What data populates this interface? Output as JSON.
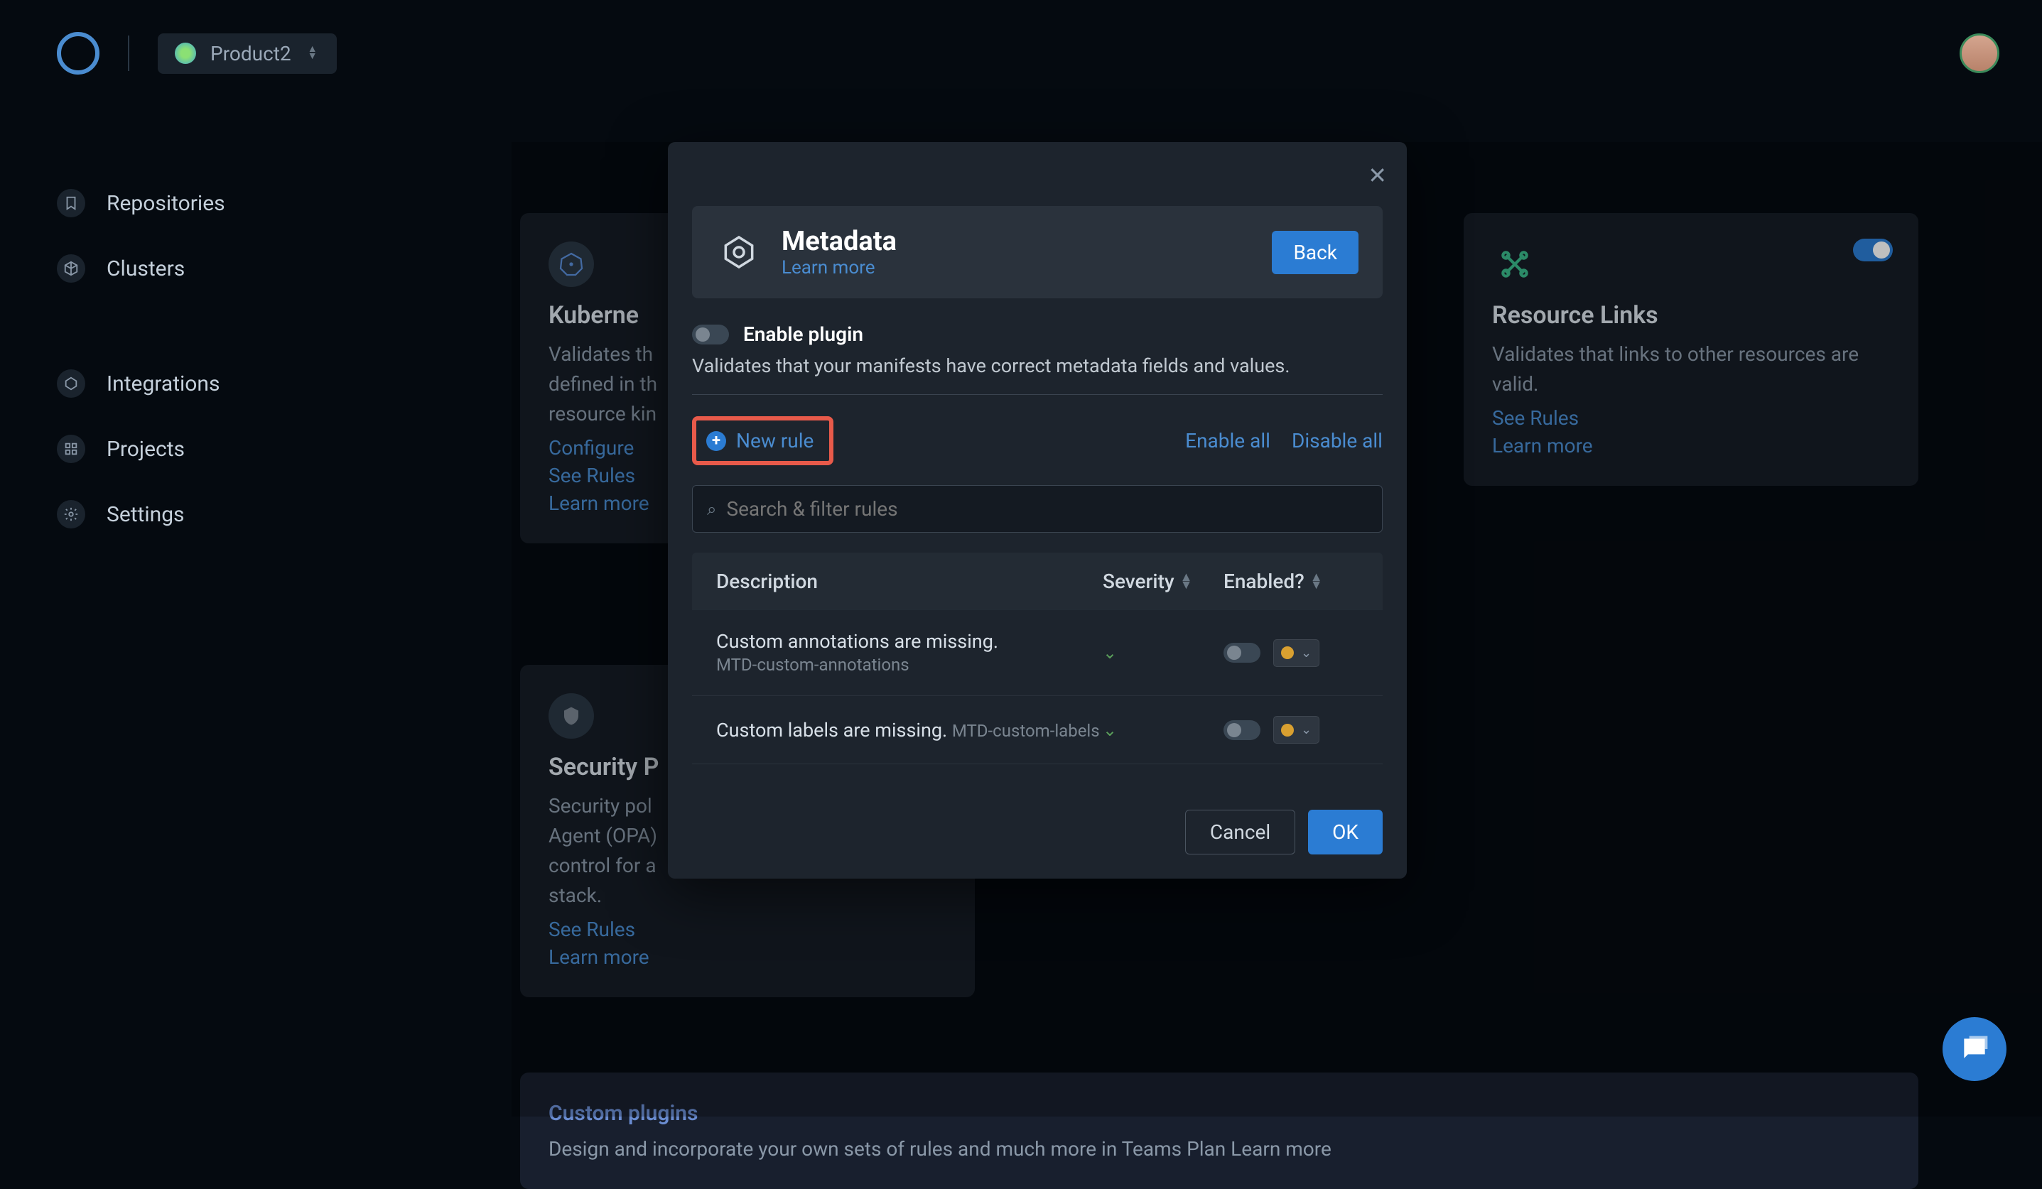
{
  "topbar": {
    "product": "Product2"
  },
  "sidebar": {
    "items": [
      {
        "label": "Repositories"
      },
      {
        "label": "Clusters"
      },
      {
        "label": "Integrations"
      },
      {
        "label": "Projects"
      },
      {
        "label": "Settings"
      }
    ]
  },
  "cards": {
    "k8s": {
      "title": "Kuberne",
      "desc": "Validates th\ndefined in th\nresource kin",
      "links": {
        "configure": "Configure",
        "see_rules": "See Rules",
        "learn": "Learn more"
      }
    },
    "resource_links": {
      "title": "Resource Links",
      "desc": "Validates that links to other resources are valid.",
      "links": {
        "see_rules": "See Rules",
        "learn": "Learn more"
      }
    },
    "security": {
      "title": "Security P",
      "desc": "Security pol\nAgent (OPA)\ncontrol for a\nstack.",
      "links": {
        "see_rules": "See Rules",
        "learn": "Learn more"
      }
    }
  },
  "banner": {
    "title": "Custom plugins",
    "desc": "Design and incorporate your own sets of rules and much more in Teams Plan  Learn more"
  },
  "modal": {
    "title": "Metadata",
    "learn": "Learn more",
    "back": "Back",
    "enable_plugin": "Enable plugin",
    "description": "Validates that your manifests have correct metadata fields and values.",
    "new_rule": "New rule",
    "enable_all": "Enable all",
    "disable_all": "Disable all",
    "search_placeholder": "Search & filter rules",
    "columns": {
      "desc": "Description",
      "sev": "Severity",
      "enabled": "Enabled?"
    },
    "rules": [
      {
        "title": "Custom annotations are missing.",
        "sub": "MTD-custom-annotations"
      },
      {
        "title": "Custom labels are missing.",
        "sub": "MTD-custom-labels"
      }
    ],
    "cancel": "Cancel",
    "ok": "OK"
  }
}
